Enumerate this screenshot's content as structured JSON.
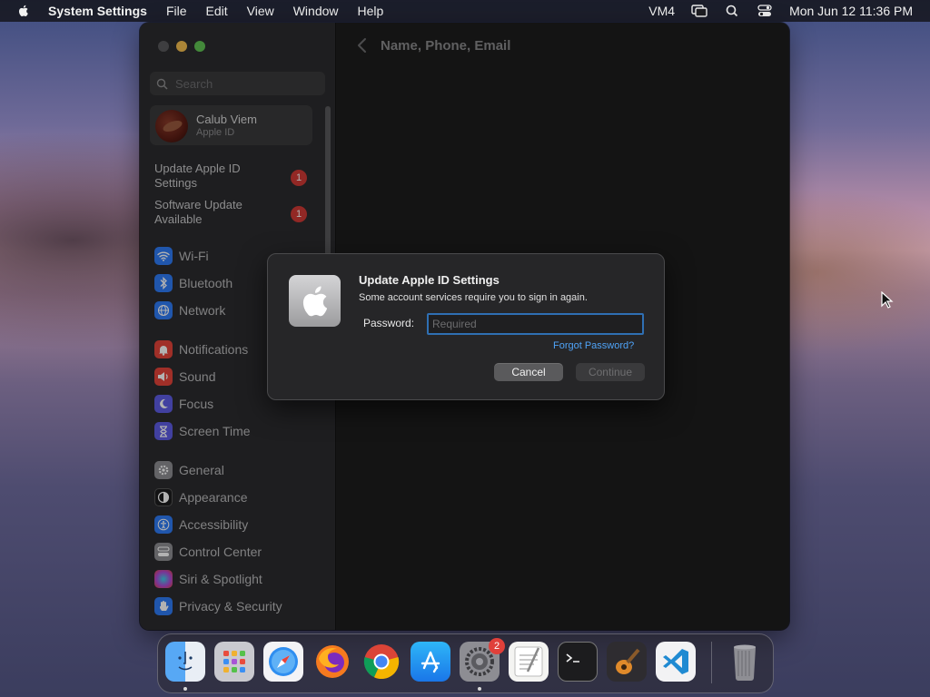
{
  "menubar": {
    "app_name": "System Settings",
    "items": [
      "File",
      "Edit",
      "View",
      "Window",
      "Help"
    ],
    "vm_label": "VM4",
    "clock": "Mon Jun 12  11:36 PM"
  },
  "window": {
    "search_placeholder": "Search",
    "account": {
      "name": "Calub Viem",
      "subtitle": "Apple ID"
    },
    "notices": [
      {
        "label": "Update Apple ID Settings",
        "badge": "1"
      },
      {
        "label": "Software Update Available",
        "badge": "1"
      }
    ],
    "sidebar_items": [
      {
        "label": "Wi-Fi",
        "icon": "wifi-icon",
        "color": "#2f7cf6"
      },
      {
        "label": "Bluetooth",
        "icon": "bluetooth-icon",
        "color": "#2f7cf6"
      },
      {
        "label": "Network",
        "icon": "globe-icon",
        "color": "#2f7cf6"
      },
      {
        "label": "Notifications",
        "icon": "bell-icon",
        "color": "#e5443a"
      },
      {
        "label": "Sound",
        "icon": "speaker-icon",
        "color": "#e5443a"
      },
      {
        "label": "Focus",
        "icon": "moon-icon",
        "color": "#5e5ce6"
      },
      {
        "label": "Screen Time",
        "icon": "hourglass-icon",
        "color": "#5e5ce6"
      },
      {
        "label": "General",
        "icon": "gear-icon",
        "color": "#8e8e93"
      },
      {
        "label": "Appearance",
        "icon": "appearance-icon",
        "color": "#1c1c1e"
      },
      {
        "label": "Accessibility",
        "icon": "accessibility-icon",
        "color": "#2f7cf6"
      },
      {
        "label": "Control Center",
        "icon": "control-center-icon",
        "color": "#8e8e93"
      },
      {
        "label": "Siri & Spotlight",
        "icon": "siri-icon",
        "color": "#b04ad8"
      },
      {
        "label": "Privacy & Security",
        "icon": "hand-icon",
        "color": "#2f7cf6"
      }
    ],
    "content_title": "Name, Phone, Email"
  },
  "dialog": {
    "title": "Update Apple ID Settings",
    "message": "Some account services require you to sign in again.",
    "password_label": "Password:",
    "password_placeholder": "Required",
    "forgot_link": "Forgot Password?",
    "cancel_label": "Cancel",
    "continue_label": "Continue"
  },
  "dock": {
    "apps": [
      "Finder",
      "Launchpad",
      "Safari",
      "Firefox",
      "Chrome",
      "App Store",
      "System Settings",
      "TextEdit",
      "Terminal",
      "GarageBand",
      "Visual Studio Code"
    ],
    "system_settings_badge": "2",
    "trash": "Trash"
  }
}
